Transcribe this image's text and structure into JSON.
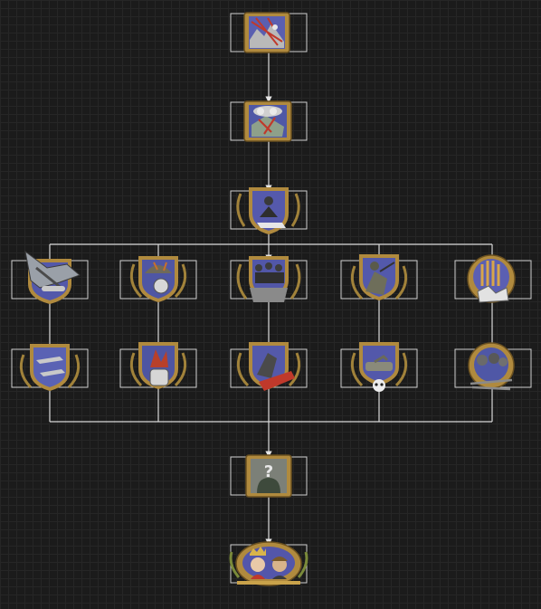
{
  "tree": {
    "nodes": [
      {
        "id": "n1",
        "icon": "war-plans-icon",
        "shape": "square",
        "field": "#5a5fb0"
      },
      {
        "id": "n2",
        "icon": "skull-map-icon",
        "shape": "square",
        "field": "#4f58a6"
      },
      {
        "id": "n3",
        "icon": "general-writing-icon",
        "shape": "shield",
        "field": "#5559ac"
      },
      {
        "id": "n4a",
        "icon": "aircraft-icon",
        "shape": "shield",
        "field": "#5358aa"
      },
      {
        "id": "n4b",
        "icon": "grenade-helmet-icon",
        "shape": "shield",
        "field": "#4f56a4"
      },
      {
        "id": "n4c",
        "icon": "infantry-squad-icon",
        "shape": "shield",
        "field": "#5257a8"
      },
      {
        "id": "n4d",
        "icon": "soldier-crouching-icon",
        "shape": "shield",
        "field": "#5359ab"
      },
      {
        "id": "n4e",
        "icon": "wheat-handshake-icon",
        "shape": "round",
        "field": "#5b5fb2"
      },
      {
        "id": "n5a",
        "icon": "fighter-planes-icon",
        "shape": "shield",
        "field": "#5a62b4"
      },
      {
        "id": "n5b",
        "icon": "raised-fist-fire-icon",
        "shape": "shield",
        "field": "#4e55a2"
      },
      {
        "id": "n5c",
        "icon": "charging-soldier-arrow-icon",
        "shape": "shield",
        "field": "#5459aa"
      },
      {
        "id": "n5d",
        "icon": "tank-skull-icon",
        "shape": "shield",
        "field": "#5358aa"
      },
      {
        "id": "n5e",
        "icon": "leaders-rifles-icon",
        "shape": "round",
        "field": "#4f57a6"
      },
      {
        "id": "n6",
        "icon": "question-mark-figure-icon",
        "shape": "square",
        "field": "#7c8078"
      },
      {
        "id": "n7",
        "icon": "king-and-girl-icon",
        "shape": "oval",
        "field": "#5356aa"
      }
    ]
  }
}
